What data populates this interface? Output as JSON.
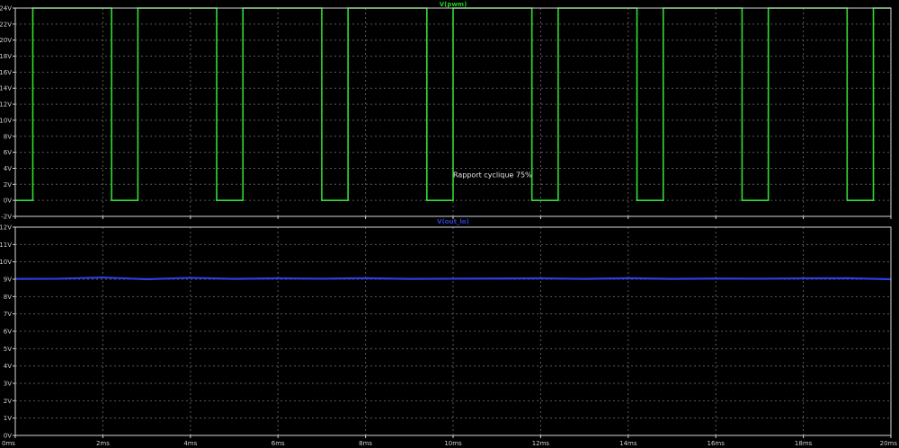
{
  "chart_data": [
    {
      "type": "line",
      "title": "V(pwm)",
      "title_color": "#22cc22",
      "series": [
        {
          "name": "V(pwm)",
          "color": "#33dd33",
          "unit": "V",
          "period_ms": 2.4,
          "duty_cycle": 0.75,
          "high": 24,
          "low": 0,
          "first_low_start_ms": 0,
          "low_intervals_ms": [
            [
              0,
              0.4
            ],
            [
              2.2,
              2.8
            ],
            [
              4.6,
              5.2
            ],
            [
              7.0,
              7.6
            ],
            [
              9.4,
              10.0
            ],
            [
              11.8,
              12.4
            ],
            [
              14.2,
              14.8
            ],
            [
              16.6,
              17.2
            ],
            [
              19.0,
              19.6
            ]
          ]
        }
      ],
      "xlim": [
        0,
        20
      ],
      "ylim": [
        -2,
        24
      ],
      "x_ticks": [
        0,
        2,
        4,
        6,
        8,
        10,
        12,
        14,
        16,
        18,
        20
      ],
      "y_ticks": [
        -2,
        0,
        2,
        4,
        6,
        8,
        10,
        12,
        14,
        16,
        18,
        20,
        22,
        24
      ],
      "y_tick_labels": [
        "-2V",
        "0V",
        "2V",
        "4V",
        "6V",
        "8V",
        "10V",
        "12V",
        "14V",
        "16V",
        "18V",
        "20V",
        "22V",
        "24V"
      ],
      "grid": true,
      "annotations": [
        {
          "text": "Rapport cyclique 75%",
          "x": 10.9,
          "y": 2.9
        }
      ]
    },
    {
      "type": "line",
      "title": "V(out_lo)",
      "title_color": "#2f3fcc",
      "series": [
        {
          "name": "V(out_lo)",
          "color": "#2a3fe0",
          "unit": "V",
          "x": [
            0,
            1,
            2,
            3,
            4,
            5,
            6,
            7,
            8,
            9,
            10,
            11,
            12,
            13,
            14,
            15,
            16,
            17,
            18,
            19,
            20
          ],
          "y": [
            9.02,
            9.03,
            9.1,
            9.0,
            9.08,
            9.02,
            9.05,
            9.03,
            9.06,
            9.02,
            9.03,
            9.04,
            9.05,
            9.02,
            9.06,
            9.02,
            9.04,
            9.03,
            9.05,
            9.06,
            9.0
          ]
        }
      ],
      "xlim": [
        0,
        20
      ],
      "ylim": [
        0,
        12
      ],
      "x_ticks": [
        0,
        2,
        4,
        6,
        8,
        10,
        12,
        14,
        16,
        18,
        20
      ],
      "x_tick_labels": [
        "0ms",
        "2ms",
        "4ms",
        "6ms",
        "8ms",
        "10ms",
        "12ms",
        "14ms",
        "16ms",
        "18ms",
        "20ms"
      ],
      "y_ticks": [
        0,
        1,
        2,
        3,
        4,
        5,
        6,
        7,
        8,
        9,
        10,
        11,
        12
      ],
      "y_tick_labels": [
        "0V",
        "1V",
        "2V",
        "3V",
        "4V",
        "5V",
        "6V",
        "7V",
        "8V",
        "9V",
        "10V",
        "11V",
        "12V"
      ],
      "grid": true
    }
  ],
  "colors": {
    "background": "#000000",
    "frame": "#d8d8d8",
    "grid": "#5a5a5a",
    "tick_text": "#cfcfcf"
  }
}
